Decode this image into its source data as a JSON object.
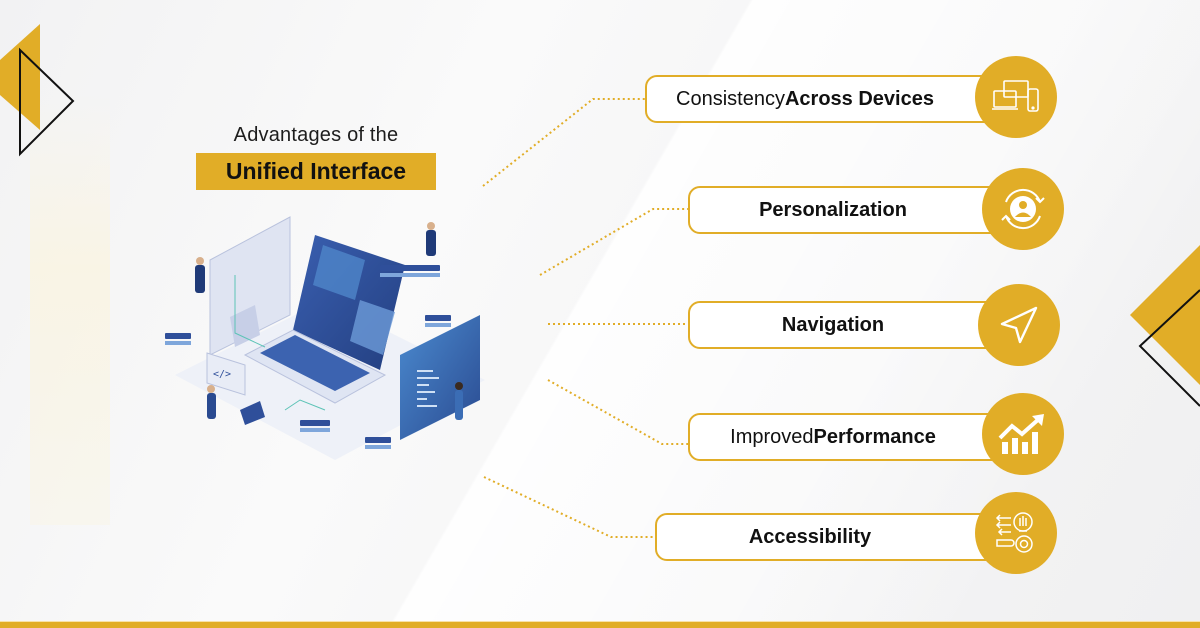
{
  "heading": {
    "line1": "Advantages of the",
    "line2": "Unified Interface"
  },
  "illustration": {
    "description": "isometric-devices-illustration"
  },
  "advantages": [
    {
      "light": "Consistency ",
      "bold": "Across Devices",
      "icon": "devices-icon"
    },
    {
      "light": "",
      "bold": "Personalization",
      "icon": "user-sync-icon"
    },
    {
      "light": "",
      "bold": "Navigation",
      "icon": "navigation-arrow-icon"
    },
    {
      "light": "Improved ",
      "bold": "Performance",
      "icon": "growth-chart-icon"
    },
    {
      "light": "",
      "bold": "Accessibility",
      "icon": "idea-gear-icon"
    }
  ],
  "colors": {
    "accent": "#e1ad27",
    "text": "#111111",
    "background": "#f4f4f5",
    "illustration_blue": "#2f4f9a"
  }
}
